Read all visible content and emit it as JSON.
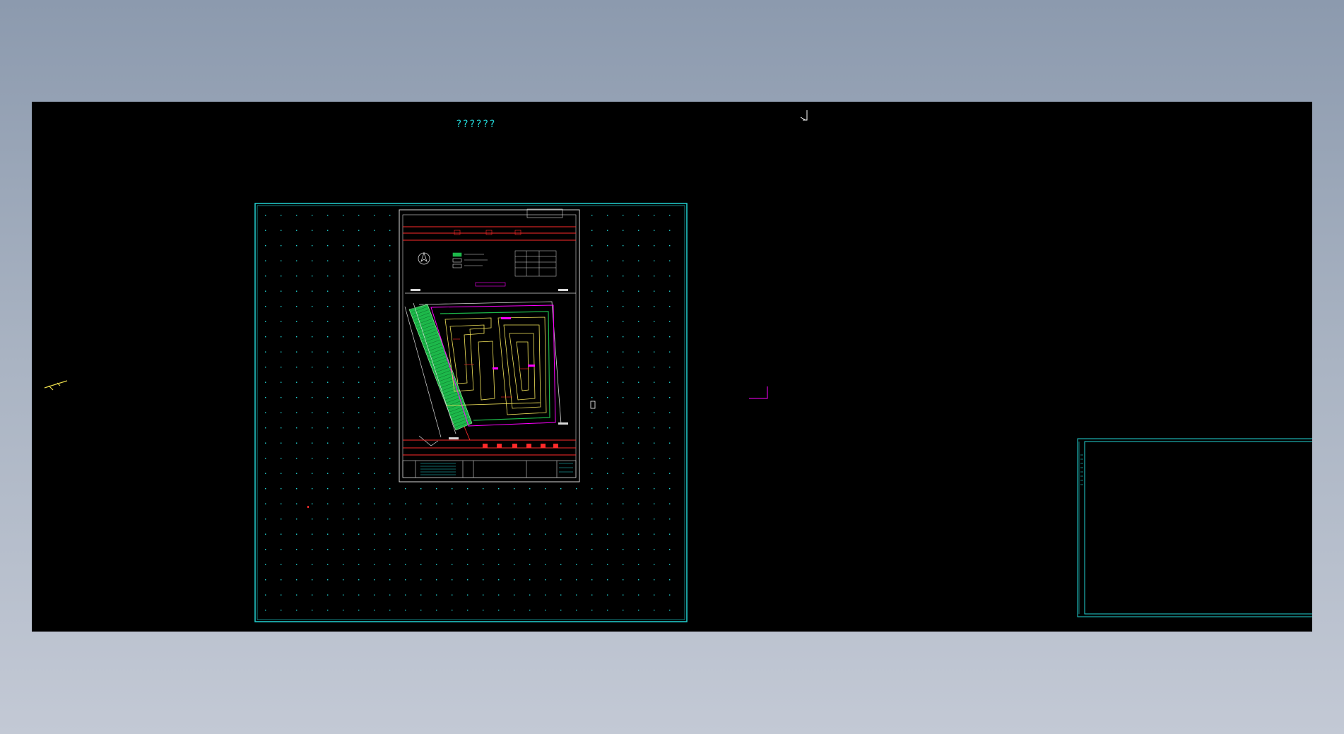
{
  "canvas": {
    "title_text": "??????",
    "background_color": "#000000",
    "grid_color": "#22d3d3",
    "frame_color": "#22d3d3",
    "accent_colors": {
      "road": "#ff2a2a",
      "boundary": "#ff00ff",
      "planting": "#1db84a",
      "contour": "#f2e35a",
      "structure": "#d9d9d9"
    }
  },
  "icons": {
    "ucs": "ucs-icon",
    "crosshair": "crosshair-cursor-icon",
    "north": "north-arrow-icon"
  }
}
